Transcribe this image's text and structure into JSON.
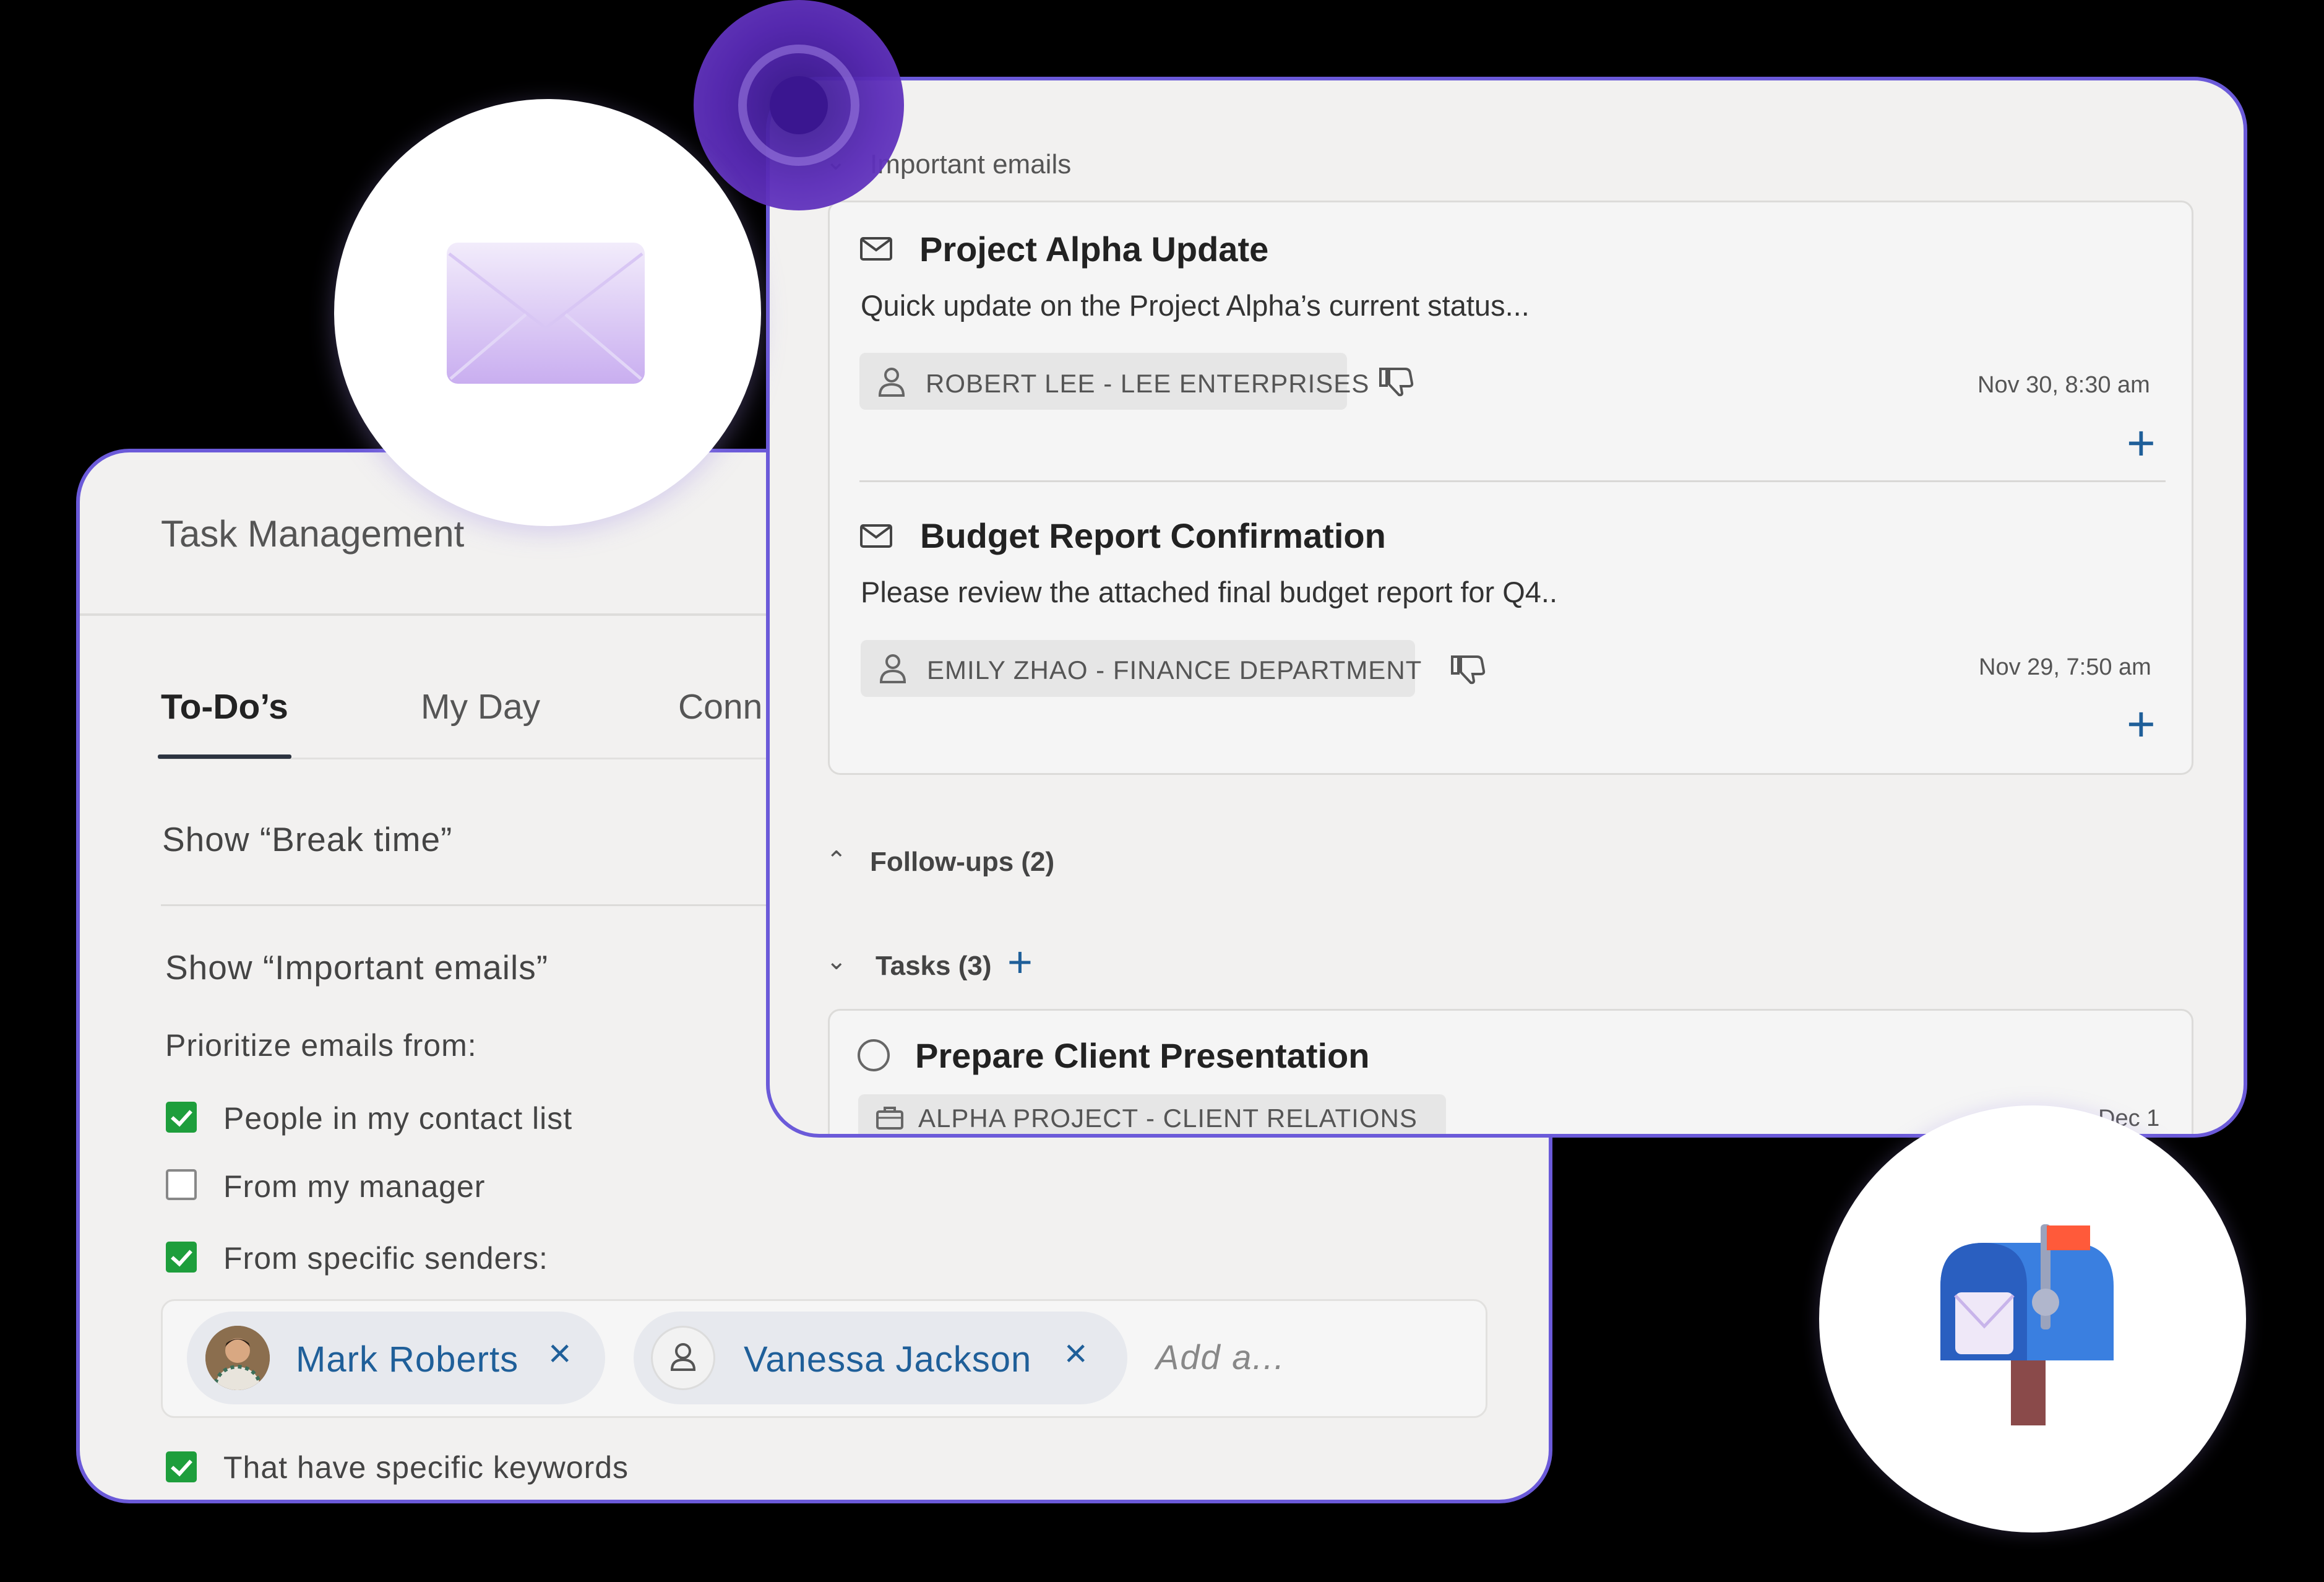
{
  "task_management": {
    "title": "Task Management",
    "tabs": [
      {
        "label": "To-Do’s"
      },
      {
        "label": "My Day"
      },
      {
        "label": "Conn"
      }
    ],
    "show_break_time": "Show “Break time”",
    "show_important_emails": "Show “Important emails”",
    "prioritize_label": "Prioritize emails from:",
    "options": [
      {
        "label": "People in my contact list",
        "checked": true
      },
      {
        "label": "From my manager",
        "checked": false
      },
      {
        "label": "From specific senders:",
        "checked": true
      },
      {
        "label": "That have specific keywords",
        "checked": true
      }
    ],
    "senders": [
      {
        "name": "Mark Roberts"
      },
      {
        "name": "Vanessa Jackson"
      }
    ],
    "add_placeholder": "Add a..."
  },
  "emails_panel": {
    "important_heading": "Important emails",
    "emails": [
      {
        "title": "Project Alpha Update",
        "preview": "Quick update on the Project Alpha’s current status...",
        "sender": "ROBERT LEE - LEE ENTERPRISES",
        "date": "Nov 30, 8:30 am"
      },
      {
        "title": "Budget Report Confirmation",
        "preview": "Please review the attached final budget report for Q4..",
        "sender": "EMILY ZHAO - FINANCE DEPARTMENT",
        "date": "Nov 29, 7:50 am"
      }
    ],
    "followups_heading": "Follow-ups (2)",
    "tasks_heading": "Tasks (3)",
    "tasks": [
      {
        "title": "Prepare Client Presentation",
        "project": "ALPHA PROJECT - CLIENT RELATIONS",
        "date": "Dec 1"
      }
    ]
  },
  "colors": {
    "accent_purple": "#6b5ad9",
    "link_blue": "#1f5f99",
    "check_green": "#1e9e3c"
  }
}
